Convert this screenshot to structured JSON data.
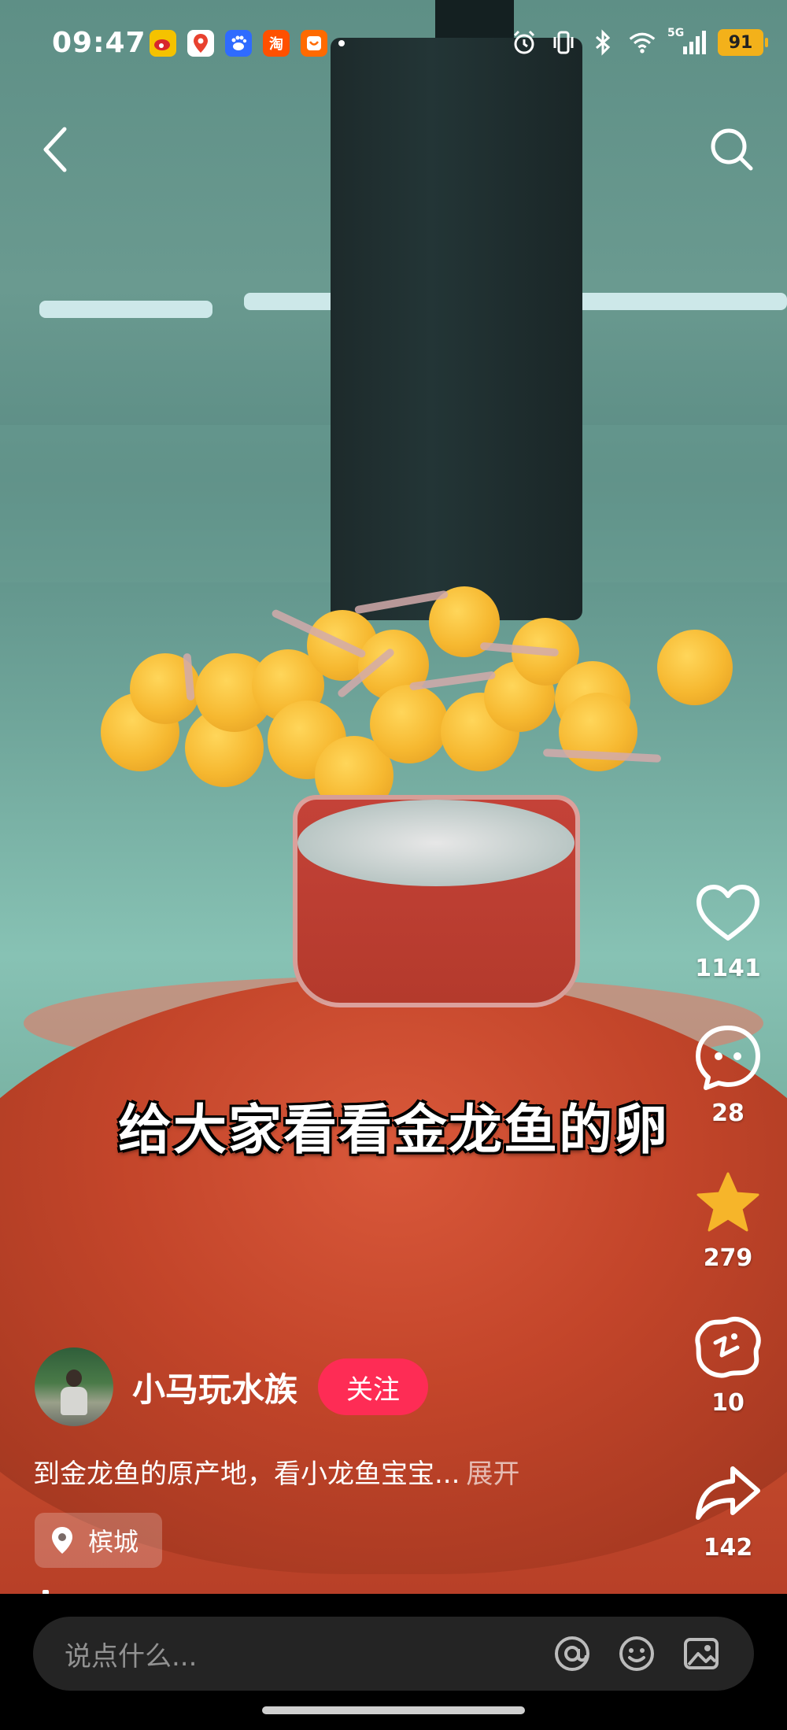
{
  "status_bar": {
    "time": "09:47",
    "notification_icons": [
      "weibo-icon",
      "location-app-icon",
      "baidu-icon",
      "taobao-icon",
      "shopping-icon"
    ],
    "taobao_glyph": "淘",
    "network_label": "5G",
    "battery": "91"
  },
  "video": {
    "caption": "给大家看看金龙鱼的卵"
  },
  "actions": {
    "like_count": "1141",
    "comment_count": "28",
    "favorite_count": "279",
    "share_alt_count": "10",
    "share_count": "142"
  },
  "author": {
    "name": "小马玩水族",
    "follow_label": "关注"
  },
  "post": {
    "description": "到金龙鱼的原产地，看小龙鱼宝宝...",
    "expand_label": "展开",
    "location": "槟城"
  },
  "comment_bar": {
    "placeholder": "说点什么..."
  },
  "colors": {
    "follow_button": "#fe2c55",
    "favorite_star": "#f6b52a",
    "battery": "#f3b11a"
  }
}
